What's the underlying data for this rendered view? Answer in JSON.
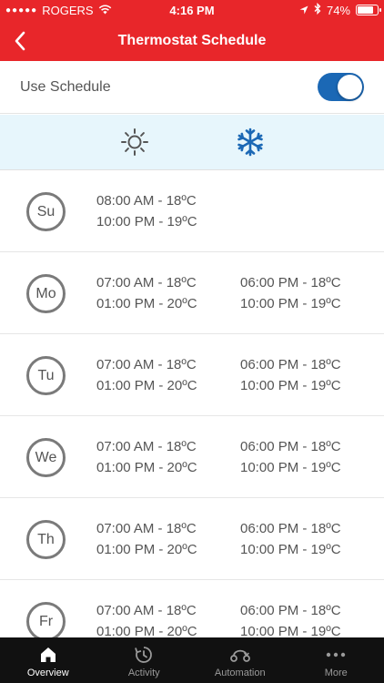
{
  "status_bar": {
    "carrier": "ROGERS",
    "time": "4:16 PM",
    "battery": "74%",
    "battery_level": 0.74
  },
  "header": {
    "title": "Thermostat Schedule",
    "back_icon": "chevron-left-icon"
  },
  "use_schedule": {
    "label": "Use Schedule",
    "enabled": true
  },
  "modes": [
    {
      "name": "heat",
      "icon": "sun-icon",
      "color": "#555555"
    },
    {
      "name": "cool",
      "icon": "snowflake-icon",
      "color": "#1b68b5",
      "selected": true
    }
  ],
  "schedule": [
    {
      "day": "Su",
      "col1": [
        "08:00 AM - 18ºC",
        "10:00 PM - 19ºC"
      ],
      "col2": []
    },
    {
      "day": "Mo",
      "col1": [
        "07:00 AM - 18ºC",
        "01:00 PM - 20ºC"
      ],
      "col2": [
        "06:00 PM - 18ºC",
        "10:00 PM - 19ºC"
      ]
    },
    {
      "day": "Tu",
      "col1": [
        "07:00 AM - 18ºC",
        "01:00 PM - 20ºC"
      ],
      "col2": [
        "06:00 PM - 18ºC",
        "10:00 PM - 19ºC"
      ]
    },
    {
      "day": "We",
      "col1": [
        "07:00 AM - 18ºC",
        "01:00 PM - 20ºC"
      ],
      "col2": [
        "06:00 PM - 18ºC",
        "10:00 PM - 19ºC"
      ]
    },
    {
      "day": "Th",
      "col1": [
        "07:00 AM - 18ºC",
        "01:00 PM - 20ºC"
      ],
      "col2": [
        "06:00 PM - 18ºC",
        "10:00 PM - 19ºC"
      ]
    },
    {
      "day": "Fr",
      "col1": [
        "07:00 AM - 18ºC",
        "01:00 PM - 20ºC"
      ],
      "col2": [
        "06:00 PM - 18ºC",
        "10:00 PM - 19ºC"
      ]
    }
  ],
  "tabbar": [
    {
      "label": "Overview",
      "icon": "home-icon",
      "active": true
    },
    {
      "label": "Activity",
      "icon": "activity-icon",
      "active": false
    },
    {
      "label": "Automation",
      "icon": "automation-icon",
      "active": false
    },
    {
      "label": "More",
      "icon": "more-icon",
      "active": false
    }
  ],
  "colors": {
    "brand_red": "#e8262a",
    "toggle_blue": "#1b68b5",
    "mode_bar_bg": "#e7f6fc",
    "tabbar_bg": "#111111"
  }
}
